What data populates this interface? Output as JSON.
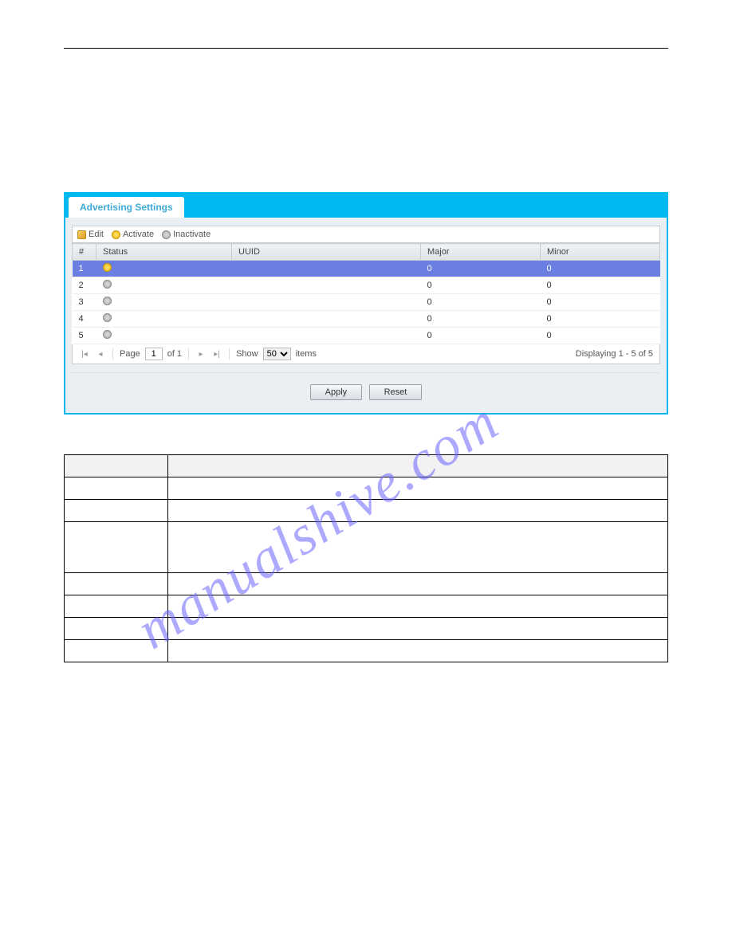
{
  "tab_label": "Advertising Settings",
  "toolbar": {
    "edit": "Edit",
    "activate": "Activate",
    "inactivate": "Inactivate"
  },
  "columns": {
    "num": "#",
    "status": "Status",
    "uuid": "UUID",
    "major": "Major",
    "minor": "Minor"
  },
  "rows": [
    {
      "num": "1",
      "status": "on",
      "uuid": "",
      "major": "0",
      "minor": "0"
    },
    {
      "num": "2",
      "status": "off",
      "uuid": "",
      "major": "0",
      "minor": "0"
    },
    {
      "num": "3",
      "status": "off",
      "uuid": "",
      "major": "0",
      "minor": "0"
    },
    {
      "num": "4",
      "status": "off",
      "uuid": "",
      "major": "0",
      "minor": "0"
    },
    {
      "num": "5",
      "status": "off",
      "uuid": "",
      "major": "0",
      "minor": "0"
    }
  ],
  "pager": {
    "page_label": "Page",
    "page_value": "1",
    "of_label": "of 1",
    "show_label": "Show",
    "show_value": "50",
    "items_label": "items",
    "display": "Displaying 1 - 5 of 5"
  },
  "buttons": {
    "apply": "Apply",
    "reset": "Reset"
  },
  "watermark": "manualshive.com"
}
